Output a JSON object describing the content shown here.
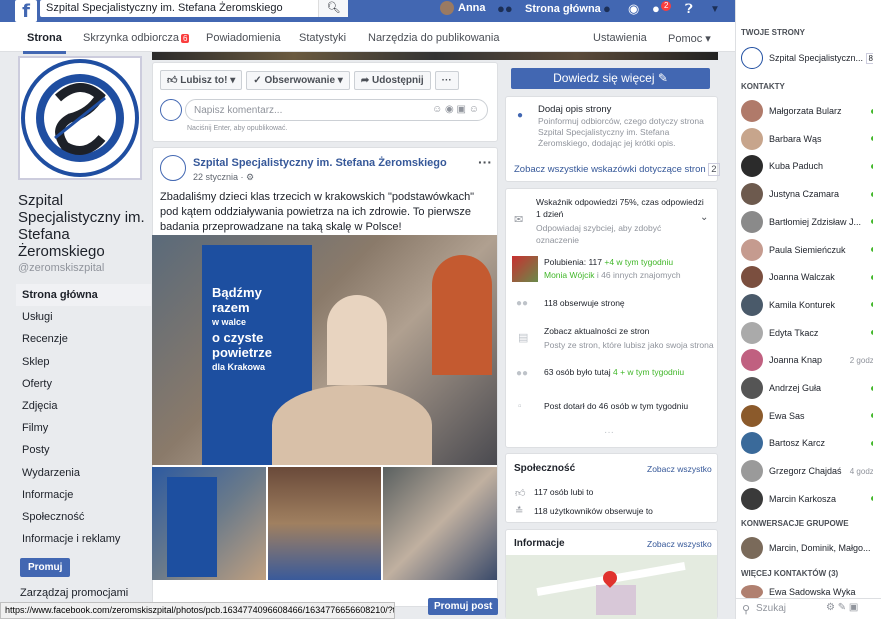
{
  "topbar": {
    "search_value": "Szpital Specjalistyczny im. Stefana Żeromskiego",
    "user_name": "Anna",
    "home_label": "Strona główna",
    "notif_count": "2"
  },
  "pagenav": {
    "tabs": [
      "Strona",
      "Skrzynka odbiorcza",
      "Powiadomienia",
      "Statystyki",
      "Narzędzia do publikowania",
      "Ustawienia",
      "Pomoc"
    ],
    "inbox_badge": "6"
  },
  "left": {
    "page_name": "Szpital Specjalistyczny im. Stefana Żeromskiego",
    "username": "@zeromskiszpital",
    "nav": [
      "Strona główna",
      "Usługi",
      "Recenzje",
      "Sklep",
      "Oferty",
      "Zdjęcia",
      "Filmy",
      "Posty",
      "Wydarzenia",
      "Informacje",
      "Społeczność",
      "Informacje i reklamy"
    ],
    "promote_btn": "Promuj",
    "manage_promo": "Zarządzaj promocjami"
  },
  "actions": {
    "like": "Lubisz to!",
    "follow": "Obserwowanie",
    "share": "Udostępnij",
    "more": "···",
    "learn_more": "Dowiedz się więcej"
  },
  "comment": {
    "placeholder": "Napisz komentarz...",
    "hint": "Naciśnij Enter, aby opublikować."
  },
  "post": {
    "author": "Szpital Specjalistyczny im. Stefana Żeromskiego",
    "date": "22 stycznia",
    "text": "Zbadaliśmy dzieci klas trzecich w krakowskich \"podstawówkach\" pod kątem oddziaływania powietrza na ich zdrowie. To pierwsze badania przeprowadzane na taką skalę w Polsce!",
    "banner_lines": [
      "Bądźmy",
      "razem",
      "w walce",
      "o czyste",
      "powietrze",
      "dla Krakowa"
    ],
    "promote_post": "Promuj post"
  },
  "right_side": {
    "add_desc_title": "Dodaj opis strony",
    "add_desc_text": "Poinformuj odbiorców, czego dotyczy strona Szpital Specjalistyczny im. Stefana Żeromskiego, dodając jej krótki opis.",
    "tips_link": "Zobacz wszystkie wskazówki dotyczące stron",
    "tips_count": "2",
    "response_rate": "Wskaźnik odpowiedzi 75%, czas odpowiedzi 1 dzień",
    "response_hint": "Odpowiadaj szybciej, aby zdobyć oznaczenie",
    "likes_label": "Polubienia:",
    "likes_count": "117",
    "likes_week": "+4 w tym tygodniu",
    "friend_name": "Monia Wójcik",
    "friends_others": "i 46 innych znajomych",
    "followers": "118 obserwuje stronę",
    "feed_title": "Zobacz aktualności ze stron",
    "feed_text": "Posty ze stron, które lubisz jako swoja strona",
    "here": "63 osób było tutaj",
    "here_week": "4 + w tym tygodniu",
    "reach": "Post dotarł do 46 osób w tym tygodniu",
    "community_title": "Społeczność",
    "see_all": "Zobacz wszystko",
    "community_likes": "117 osób lubi to",
    "community_follows": "118 użytkowników obserwuje to",
    "info_title": "Informacje"
  },
  "sidebar": {
    "your_pages": "TWOJE STRONY",
    "page_item": "Szpital Specjalistyczn...",
    "page_badge": "8",
    "contacts": "KONTAKTY",
    "people": [
      {
        "name": "Małgorzata Bularz",
        "time": "",
        "color": "#b07a6a"
      },
      {
        "name": "Barbara Wąs",
        "time": "",
        "color": "#c7a58c"
      },
      {
        "name": "Kuba Paduch",
        "time": "",
        "color": "#2b2b2b"
      },
      {
        "name": "Justyna Czamara",
        "time": "",
        "color": "#6d5a4e"
      },
      {
        "name": "Bartłomiej Zdzisław J...",
        "time": "",
        "color": "#8a8a8a"
      },
      {
        "name": "Paula Siemieńczuk",
        "time": "",
        "color": "#c59b8f"
      },
      {
        "name": "Joanna Walczak",
        "time": "",
        "color": "#7b4f3f"
      },
      {
        "name": "Kamila Konturek",
        "time": "",
        "color": "#4a5a6a"
      },
      {
        "name": "Edyta Tkacz",
        "time": "",
        "color": "#aaa"
      },
      {
        "name": "Joanna Knap",
        "time": "2 godz.",
        "color": "#c06080"
      },
      {
        "name": "Andrzej Guła",
        "time": "",
        "color": "#555"
      },
      {
        "name": "Ewa Sas",
        "time": "",
        "color": "#8b5a2b"
      },
      {
        "name": "Bartosz Karcz",
        "time": "",
        "color": "#3a6a9a"
      },
      {
        "name": "Grzegorz Chajdaś",
        "time": "4 godz.",
        "color": "#9a9a9a"
      },
      {
        "name": "Marcin Karkosza",
        "time": "",
        "color": "#3a3a3a"
      }
    ],
    "groups": "KONWERSACJE GRUPOWE",
    "group_item": "Marcin, Dominik, Małgo...",
    "more_contacts": "WIĘCEJ KONTAKTÓW (3)",
    "more_person": "Ewa Sadowska Wyka",
    "search_placeholder": "Szukaj"
  },
  "statusbar": "https://www.facebook.com/zeromskiszpital/photos/pcb.1634774096608466/1634776656608210/?type=3"
}
